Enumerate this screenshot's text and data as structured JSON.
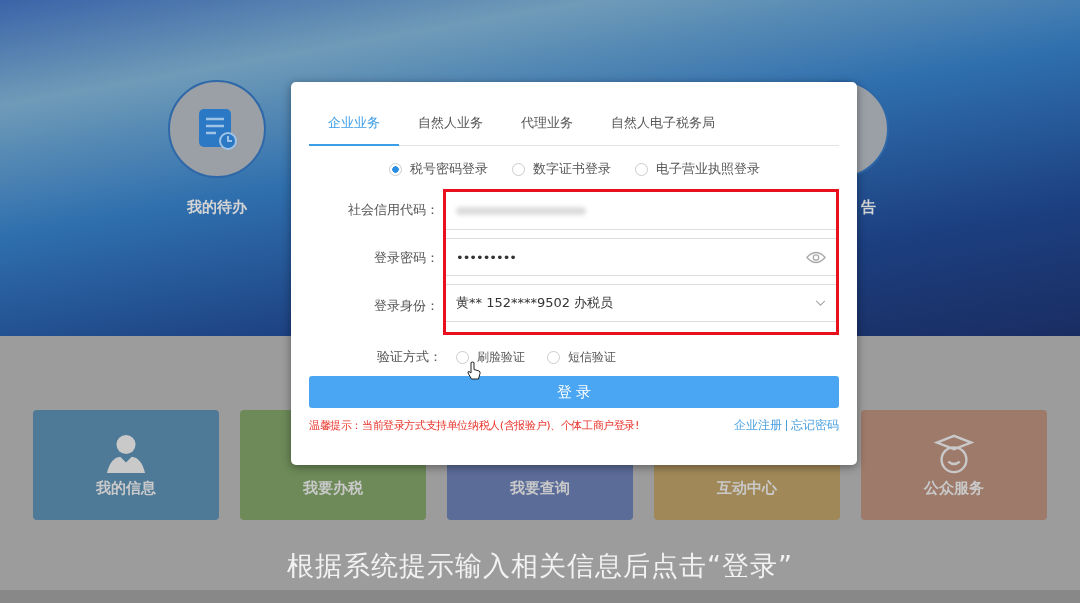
{
  "banner": {
    "shortcuts": [
      {
        "label": "我的待办"
      },
      {
        "label": "告"
      }
    ]
  },
  "cards": [
    {
      "label": "我的信息",
      "color": "#4e7997"
    },
    {
      "label": "我要办税",
      "color": "#6d8a58"
    },
    {
      "label": "我要查询",
      "color": "#5b6c98"
    },
    {
      "label": "互动中心",
      "color": "#a08858"
    },
    {
      "label": "公众服务",
      "color": "#9d7a6a"
    }
  ],
  "login_dialog": {
    "tabs": [
      {
        "label": "企业业务",
        "selected": true
      },
      {
        "label": "自然人业务",
        "selected": false
      },
      {
        "label": "代理业务",
        "selected": false
      },
      {
        "label": "自然人电子税务局",
        "selected": false
      }
    ],
    "login_methods": [
      {
        "label": "税号密码登录",
        "selected": true
      },
      {
        "label": "数字证书登录",
        "selected": false
      },
      {
        "label": "电子营业执照登录",
        "selected": false
      }
    ],
    "fields": [
      {
        "label": "社会信用代码：",
        "kind": "blurred"
      },
      {
        "label": "登录密码：",
        "kind": "password",
        "value": "•••••••••"
      },
      {
        "label": "登录身份：",
        "kind": "select",
        "value": "黄** 152****9502 办税员"
      }
    ],
    "verification": {
      "label": "验证方式：",
      "options": [
        {
          "label": "刷脸验证",
          "selected": false
        },
        {
          "label": "短信验证",
          "selected": false
        }
      ]
    },
    "login_button": "登 录",
    "notice": "温馨提示：当前登录方式支持单位纳税人(含报验户)、个体工商户登录!",
    "links": [
      "企业注册",
      "忘记密码"
    ]
  },
  "caption": "根据系统提示输入相关信息后点击“登录”"
}
